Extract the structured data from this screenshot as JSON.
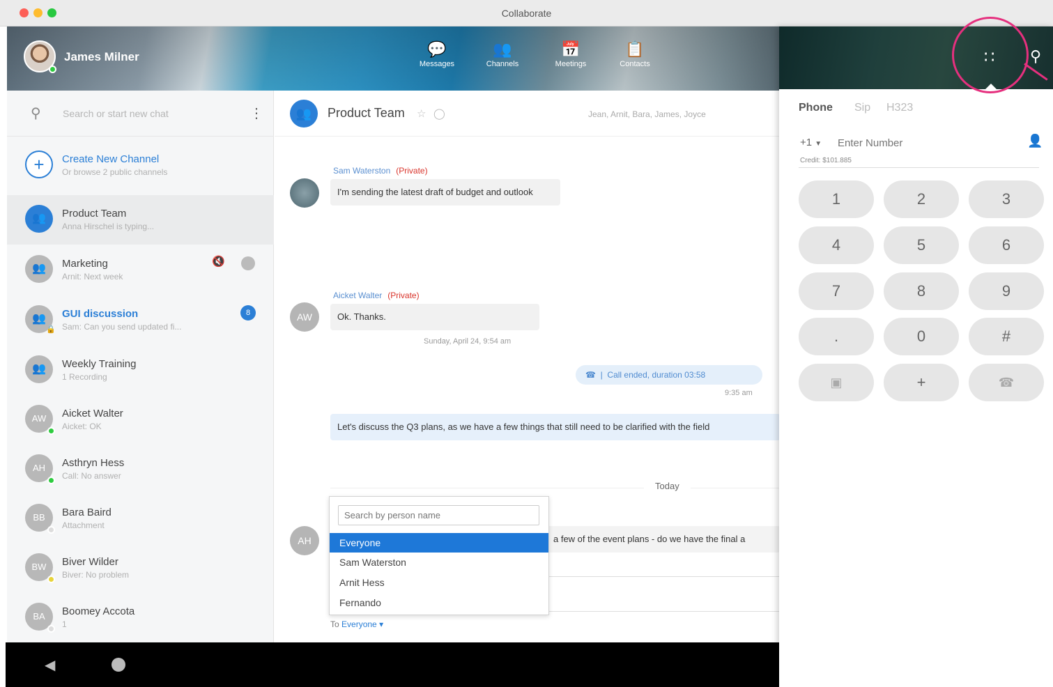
{
  "window": {
    "title": "Collaborate"
  },
  "user": {
    "name": "James Milner"
  },
  "nav": [
    {
      "label": "Messages",
      "icon": "messages-icon"
    },
    {
      "label": "Channels",
      "icon": "channels-icon"
    },
    {
      "label": "Meetings",
      "icon": "meetings-icon"
    },
    {
      "label": "Contacts",
      "icon": "contacts-icon"
    }
  ],
  "sidebar": {
    "search_placeholder": "Search or start new chat",
    "items": [
      {
        "name": "Create New Channel",
        "sub": "Or browse 2 public channels"
      },
      {
        "name": "Product Team",
        "sub": "Anna Hirschel is typing..."
      },
      {
        "name": "Marketing",
        "sub": "Arnit: Next week"
      },
      {
        "name": "GUI discussion",
        "sub": "Sam: Can you send updated fi...",
        "badge": "8"
      },
      {
        "name": "Weekly Training",
        "sub": "1 Recording"
      },
      {
        "name": "Aicket Walter",
        "initials": "AW",
        "sub": "Aicket: OK"
      },
      {
        "name": "Asthryn Hess",
        "initials": "AH",
        "sub": "Call: No answer"
      },
      {
        "name": "Bara Baird",
        "initials": "BB",
        "sub": "Attachment"
      },
      {
        "name": "Biver Wilder",
        "initials": "BW",
        "sub": "Biver: No problem"
      },
      {
        "name": "Boomey Accota",
        "initials": "BA",
        "sub": "1"
      }
    ]
  },
  "chat": {
    "title": "Product Team",
    "members": "Jean, Arnit, Bara, James, Joyce",
    "messages": [
      {
        "sender": "Sam Waterston",
        "tag": "(Private)",
        "text": "I'm sending the latest draft of budget and outlook"
      },
      {
        "sender": "Aicket Walter",
        "tag": "(Private)",
        "initials": "AW",
        "text": "Ok. Thanks.",
        "time": "Sunday, April 24, 9:54 am"
      },
      {
        "call": "Call ended, duration 03:58",
        "time": "9:35 am"
      },
      {
        "text": "Let's discuss the Q3 plans, as we have a few things that still need to be clarified with the field"
      },
      {
        "separator": "Today"
      },
      {
        "initials": "AH",
        "text": "a few of the event plans - do we have the final a"
      }
    ],
    "mention": {
      "placeholder": "Search by person name",
      "options": [
        "Everyone",
        "Sam Waterston",
        "Arnit Hess",
        "Fernando"
      ],
      "selected": "Everyone"
    },
    "to_label": "To",
    "to_value": "Everyone"
  },
  "phone": {
    "tabs": [
      "Phone",
      "Sip",
      "H323"
    ],
    "country_code": "+1",
    "number_placeholder": "Enter Number",
    "credit": "Credit: $101.885",
    "keys": [
      "1",
      "2",
      "3",
      "4",
      "5",
      "6",
      "7",
      "8",
      "9",
      ".",
      "0",
      "#"
    ],
    "plus": "+"
  },
  "colors": {
    "accent": "#2b7fd6",
    "highlight_ring": "#e5307e",
    "online": "#2ecc40",
    "away": "#e8d43a"
  }
}
